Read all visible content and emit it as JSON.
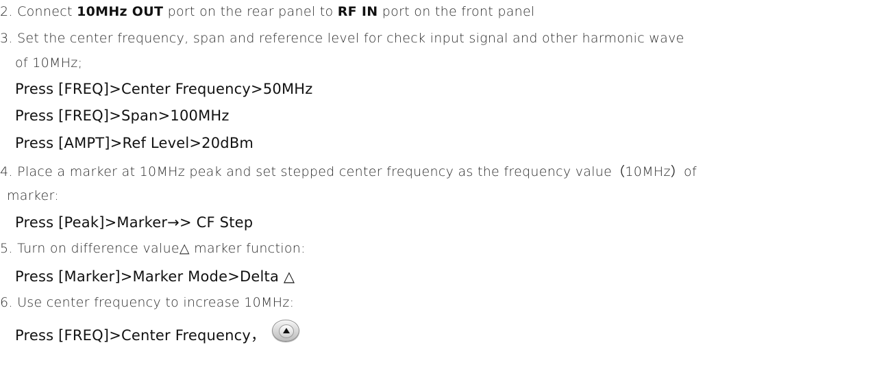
{
  "steps": {
    "s2": {
      "prefix": "2. Connect ",
      "bold1": "10MHz OUT",
      "mid": " port on the rear panel to ",
      "bold2": "RF IN",
      "suffix": " port on the front panel"
    },
    "s3": {
      "line1": "3. Set the center frequency, span and reference level for check input signal and other harmonic wave",
      "line2": "of 10MHz;",
      "cmd1": "Press [FREQ]>Center Frequency>50MHz",
      "cmd2": "Press [FREQ]>Span>100MHz",
      "cmd3": "Press [AMPT]>Ref Level>20dBm"
    },
    "s4": {
      "line1": "4. Place a marker at 10MHz peak and set stepped center frequency as the frequency value（10MHz）of",
      "line2": "marker:",
      "cmd": "Press [Peak]>Marker→> CF Step"
    },
    "s5": {
      "line": "5. Turn on difference value△  marker function:",
      "cmd": "Press [Marker]>Marker Mode>Delta  △"
    },
    "s6": {
      "line": "6. Use center frequency to increase 10MHz:",
      "cmd": "Press [FREQ]>Center Frequency，"
    }
  },
  "icons": {
    "up_button": "up-arrow-key-icon"
  }
}
